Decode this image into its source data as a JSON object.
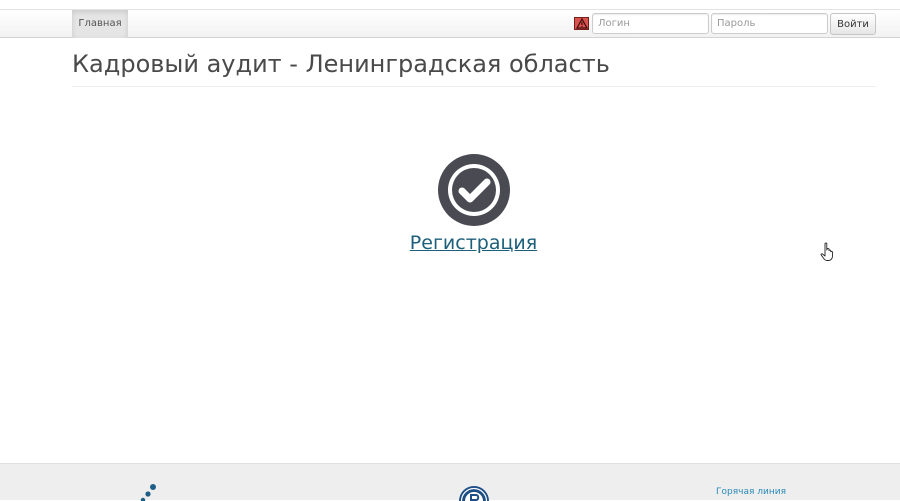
{
  "navbar": {
    "home_label": "Главная",
    "alert_icon": "warning-icon",
    "login_placeholder": "Логин",
    "password_placeholder": "Пароль",
    "login_button_label": "Войти"
  },
  "main": {
    "title": "Кадровый аудит - Ленинградская область",
    "status_icon": "check-circle-icon",
    "register_link": "Регистрация"
  },
  "footer": {
    "hotline_link": "Горячая линия"
  },
  "colors": {
    "link": "#1c5f7a",
    "icon": "#4a4a52",
    "footer_link": "#2a8ab8",
    "alert": "#d9534f"
  }
}
